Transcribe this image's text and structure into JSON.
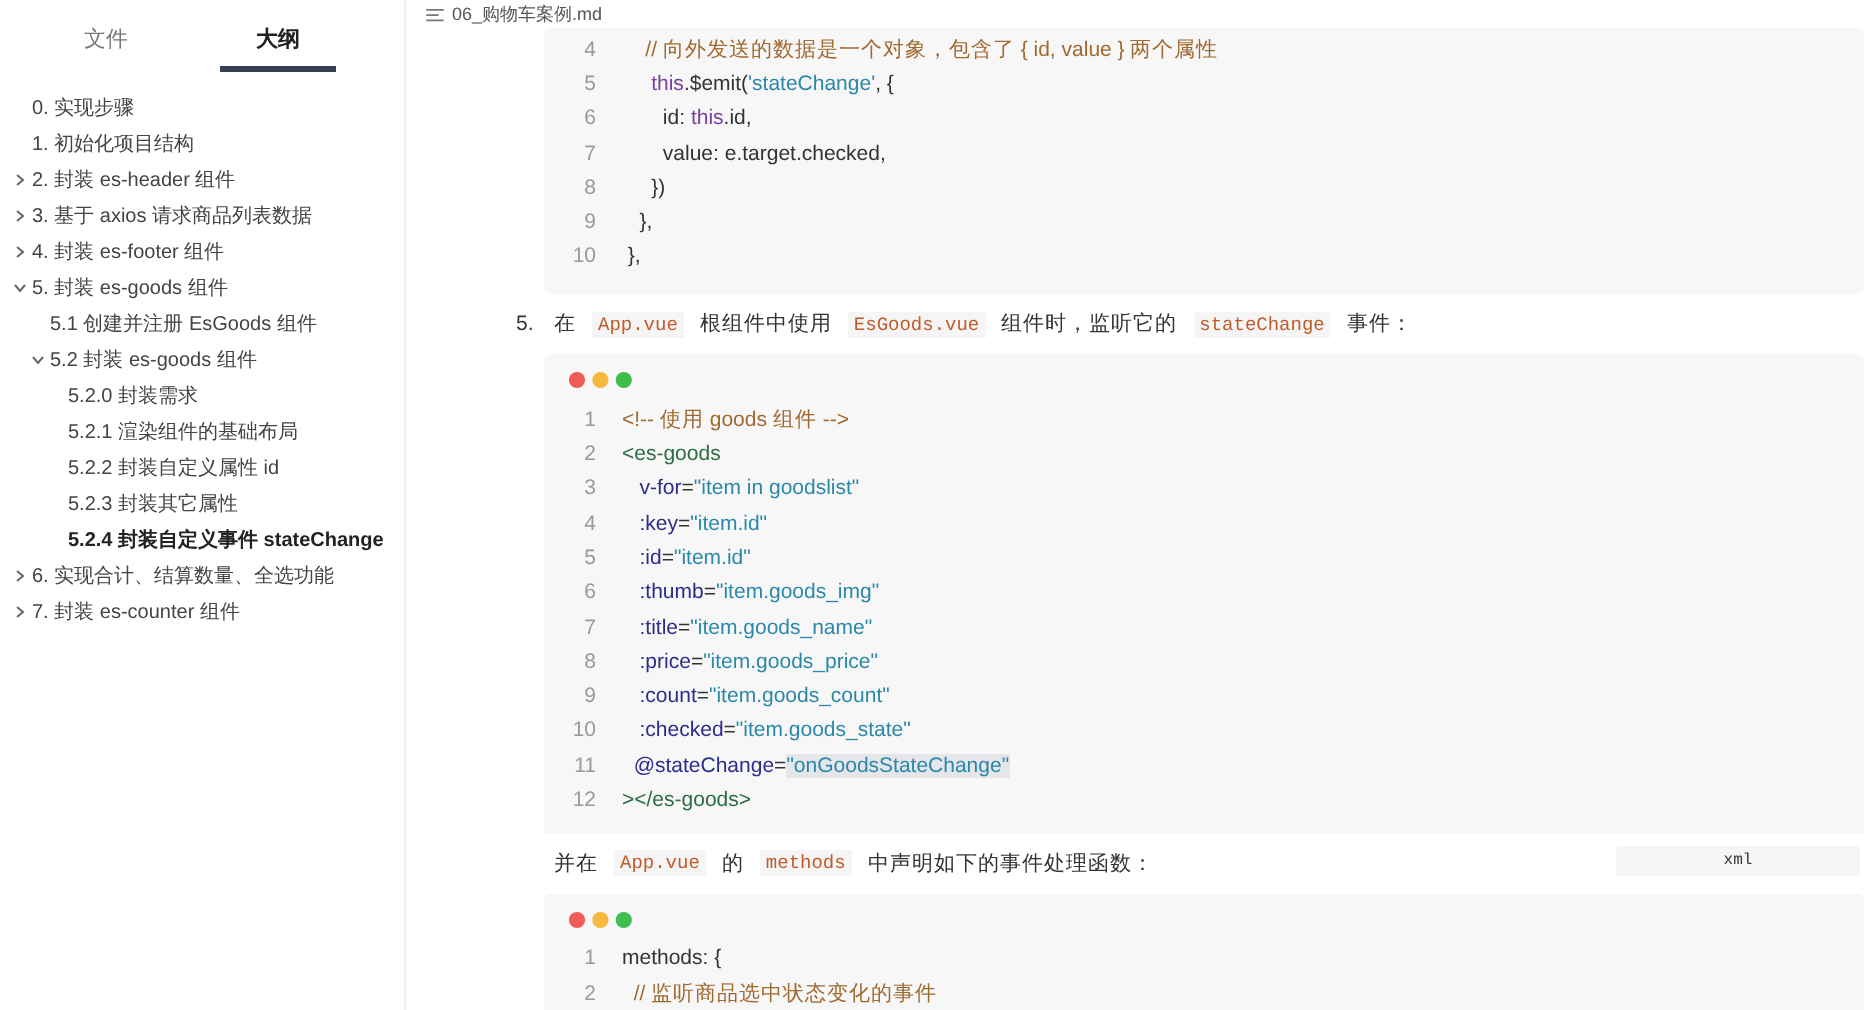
{
  "sidebar": {
    "tabs": [
      {
        "label": "文件",
        "selected": false
      },
      {
        "label": "大纲",
        "selected": true
      }
    ],
    "outline": [
      {
        "label": "0. 实现步骤",
        "kind": "leaf",
        "selected": false
      },
      {
        "label": "1. 初始化项目结构",
        "kind": "leaf",
        "selected": false
      },
      {
        "label": "2. 封装 es-header 组件",
        "kind": "collapsed",
        "selected": false
      },
      {
        "label": "3. 基于 axios 请求商品列表数据",
        "kind": "collapsed",
        "selected": false
      },
      {
        "label": "4. 封装 es-footer 组件",
        "kind": "collapsed",
        "selected": false
      },
      {
        "label": "5. 封装 es-goods 组件",
        "kind": "expanded",
        "selected": false,
        "children": [
          {
            "label": "5.1 创建并注册 EsGoods 组件",
            "kind": "leaf",
            "selected": false
          },
          {
            "label": "5.2 封装 es-goods 组件",
            "kind": "expanded",
            "selected": false,
            "children": [
              {
                "label": "5.2.0 封装需求",
                "selected": false
              },
              {
                "label": "5.2.1 渲染组件的基础布局",
                "selected": false
              },
              {
                "label": "5.2.2 封装自定义属性 id",
                "selected": false
              },
              {
                "label": "5.2.3 封装其它属性",
                "selected": false
              },
              {
                "label": "5.2.4 封装自定义事件 stateChange",
                "selected": true
              }
            ]
          }
        ]
      },
      {
        "label": "6. 实现合计、结算数量、全选功能",
        "kind": "collapsed",
        "selected": false
      },
      {
        "label": "7. 封装 es-counter 组件",
        "kind": "collapsed",
        "selected": false
      }
    ]
  },
  "document": {
    "title": "06_购物车案例.md",
    "blocks": [
      {
        "kind": "code",
        "dots": false,
        "lines": [
          {
            "n": "4",
            "tokens": [
              {
                "kind": "comment",
                "text": "    // 向外发送的数据是一个对象，包含了 { id, value } 两个属性"
              }
            ]
          },
          {
            "n": "5",
            "tokens": [
              {
                "kind": "keyword",
                "text": "     this"
              },
              {
                "kind": "plain",
                "text": ".$emit("
              },
              {
                "kind": "string",
                "text": "'stateChange'"
              },
              {
                "kind": "plain",
                "text": ", {"
              }
            ]
          },
          {
            "n": "6",
            "tokens": [
              {
                "kind": "plain",
                "text": "       id: "
              },
              {
                "kind": "keyword",
                "text": "this"
              },
              {
                "kind": "plain",
                "text": ".id,"
              }
            ]
          },
          {
            "n": "7",
            "tokens": [
              {
                "kind": "plain",
                "text": "       value: e.target.checked,"
              }
            ]
          },
          {
            "n": "8",
            "tokens": [
              {
                "kind": "plain",
                "text": "     })"
              }
            ]
          },
          {
            "n": "9",
            "tokens": [
              {
                "kind": "plain",
                "text": "   },"
              }
            ]
          },
          {
            "n": "10",
            "tokens": [
              {
                "kind": "plain",
                "text": " },"
              }
            ]
          }
        ]
      },
      {
        "kind": "paragraph",
        "number": "5.",
        "segments": [
          {
            "kind": "text",
            "text": "在"
          },
          {
            "kind": "code",
            "text": "App.vue"
          },
          {
            "kind": "text",
            "text": "根组件中使用"
          },
          {
            "kind": "code",
            "text": "EsGoods.vue"
          },
          {
            "kind": "text",
            "text": "组件时，监听它的"
          },
          {
            "kind": "code",
            "text": "stateChange"
          },
          {
            "kind": "text",
            "text": "事件："
          }
        ]
      },
      {
        "kind": "code",
        "dots": true,
        "language": "xml",
        "lines": [
          {
            "n": "1",
            "tokens": [
              {
                "kind": "comment",
                "text": "<!-- 使用 goods 组件 -->"
              }
            ]
          },
          {
            "n": "2",
            "tokens": [
              {
                "kind": "tag",
                "text": "<es-goods"
              }
            ]
          },
          {
            "n": "3",
            "tokens": [
              {
                "kind": "attr",
                "text": "   v-for"
              },
              {
                "kind": "plain",
                "text": "="
              },
              {
                "kind": "string",
                "text": "\"item in goodslist\""
              }
            ]
          },
          {
            "n": "4",
            "tokens": [
              {
                "kind": "attr",
                "text": "   :key"
              },
              {
                "kind": "plain",
                "text": "="
              },
              {
                "kind": "string",
                "text": "\"item.id\""
              }
            ]
          },
          {
            "n": "5",
            "tokens": [
              {
                "kind": "attr",
                "text": "   :id"
              },
              {
                "kind": "plain",
                "text": "="
              },
              {
                "kind": "string",
                "text": "\"item.id\""
              }
            ]
          },
          {
            "n": "6",
            "tokens": [
              {
                "kind": "attr",
                "text": "   :thumb"
              },
              {
                "kind": "plain",
                "text": "="
              },
              {
                "kind": "string",
                "text": "\"item.goods_img\""
              }
            ]
          },
          {
            "n": "7",
            "tokens": [
              {
                "kind": "attr",
                "text": "   :title"
              },
              {
                "kind": "plain",
                "text": "="
              },
              {
                "kind": "string",
                "text": "\"item.goods_name\""
              }
            ]
          },
          {
            "n": "8",
            "tokens": [
              {
                "kind": "attr",
                "text": "   :price"
              },
              {
                "kind": "plain",
                "text": "="
              },
              {
                "kind": "string",
                "text": "\"item.goods_price\""
              }
            ]
          },
          {
            "n": "9",
            "tokens": [
              {
                "kind": "attr",
                "text": "   :count"
              },
              {
                "kind": "plain",
                "text": "="
              },
              {
                "kind": "string",
                "text": "\"item.goods_count\""
              }
            ]
          },
          {
            "n": "10",
            "tokens": [
              {
                "kind": "attr",
                "text": "   :checked"
              },
              {
                "kind": "plain",
                "text": "="
              },
              {
                "kind": "string",
                "text": "\"item.goods_state\""
              }
            ]
          },
          {
            "n": "11",
            "tokens": [
              {
                "kind": "attr",
                "text": "  @stateChange"
              },
              {
                "kind": "plain",
                "text": "="
              },
              {
                "kind": "highlight",
                "text": "\"onGoodsStateChange\""
              }
            ]
          },
          {
            "n": "12",
            "tokens": [
              {
                "kind": "tag",
                "text": "></es-goods>"
              }
            ]
          }
        ]
      },
      {
        "kind": "paragraph",
        "segments": [
          {
            "kind": "text",
            "text": "并在"
          },
          {
            "kind": "code",
            "text": "App.vue"
          },
          {
            "kind": "text",
            "text": "的"
          },
          {
            "kind": "code",
            "text": "methods"
          },
          {
            "kind": "text",
            "text": "中声明如下的事件处理函数："
          }
        ]
      },
      {
        "kind": "code",
        "dots": true,
        "lines": [
          {
            "n": "1",
            "tokens": [
              {
                "kind": "plain",
                "text": "methods: {"
              }
            ]
          },
          {
            "n": "2",
            "tokens": [
              {
                "kind": "comment",
                "text": "  // 监听商品选中状态变化的事件"
              }
            ]
          }
        ]
      }
    ]
  }
}
